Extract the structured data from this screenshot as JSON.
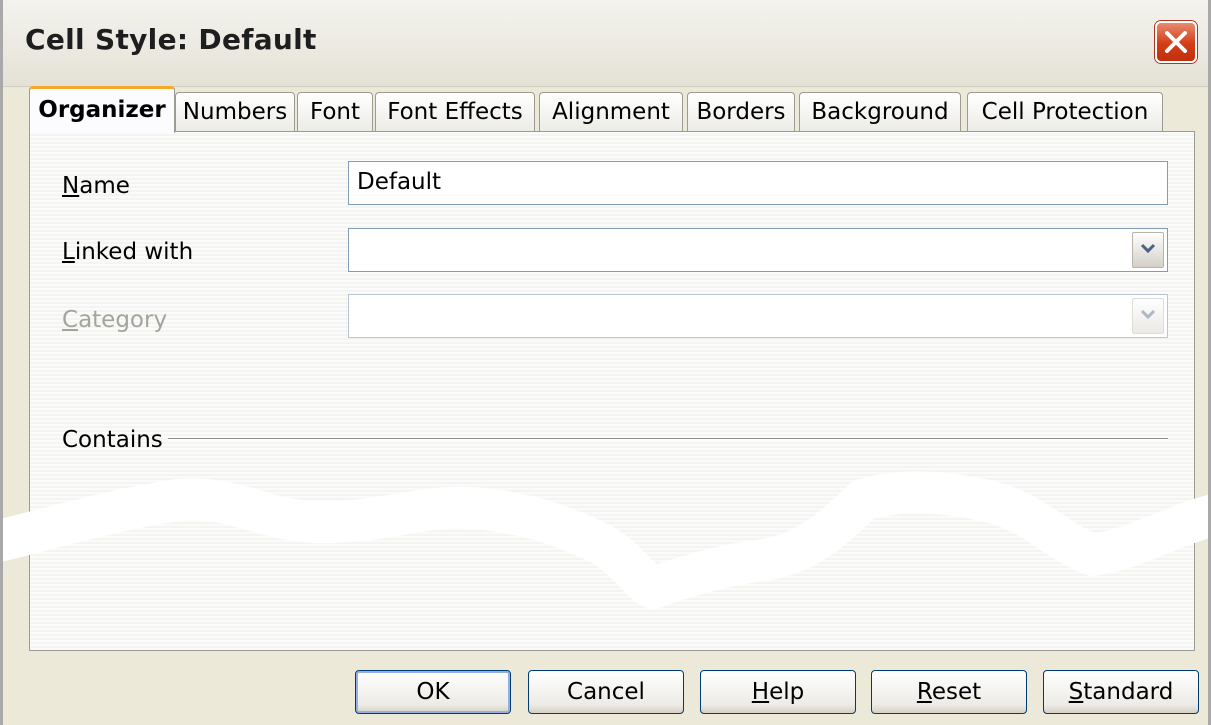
{
  "dialog": {
    "title": "Cell Style: Default",
    "close_icon": "close-icon"
  },
  "tabs": [
    {
      "label": "Organizer",
      "active": true
    },
    {
      "label": "Numbers"
    },
    {
      "label": "Font"
    },
    {
      "label": "Font Effects"
    },
    {
      "label": "Alignment"
    },
    {
      "label": "Borders"
    },
    {
      "label": "Background"
    },
    {
      "label": "Cell Protection"
    }
  ],
  "organizer": {
    "name_label_key": "N",
    "name_label_rest": "ame",
    "name_value": "Default",
    "linked_label_key": "L",
    "linked_label_rest": "inked with",
    "linked_value": "",
    "category_label_key": "C",
    "category_label_rest": "ategory",
    "category_value": "",
    "contains_label": "Contains"
  },
  "buttons": {
    "ok": "OK",
    "cancel": "Cancel",
    "help_key": "H",
    "help_rest": "elp",
    "reset_key": "R",
    "reset_rest": "eset",
    "standard_key": "S",
    "standard_rest": "tandard"
  },
  "colors": {
    "dialog_bg": "#ece9d8",
    "active_tab_accent": "#f5a82c",
    "close_button": "#d23e16"
  }
}
